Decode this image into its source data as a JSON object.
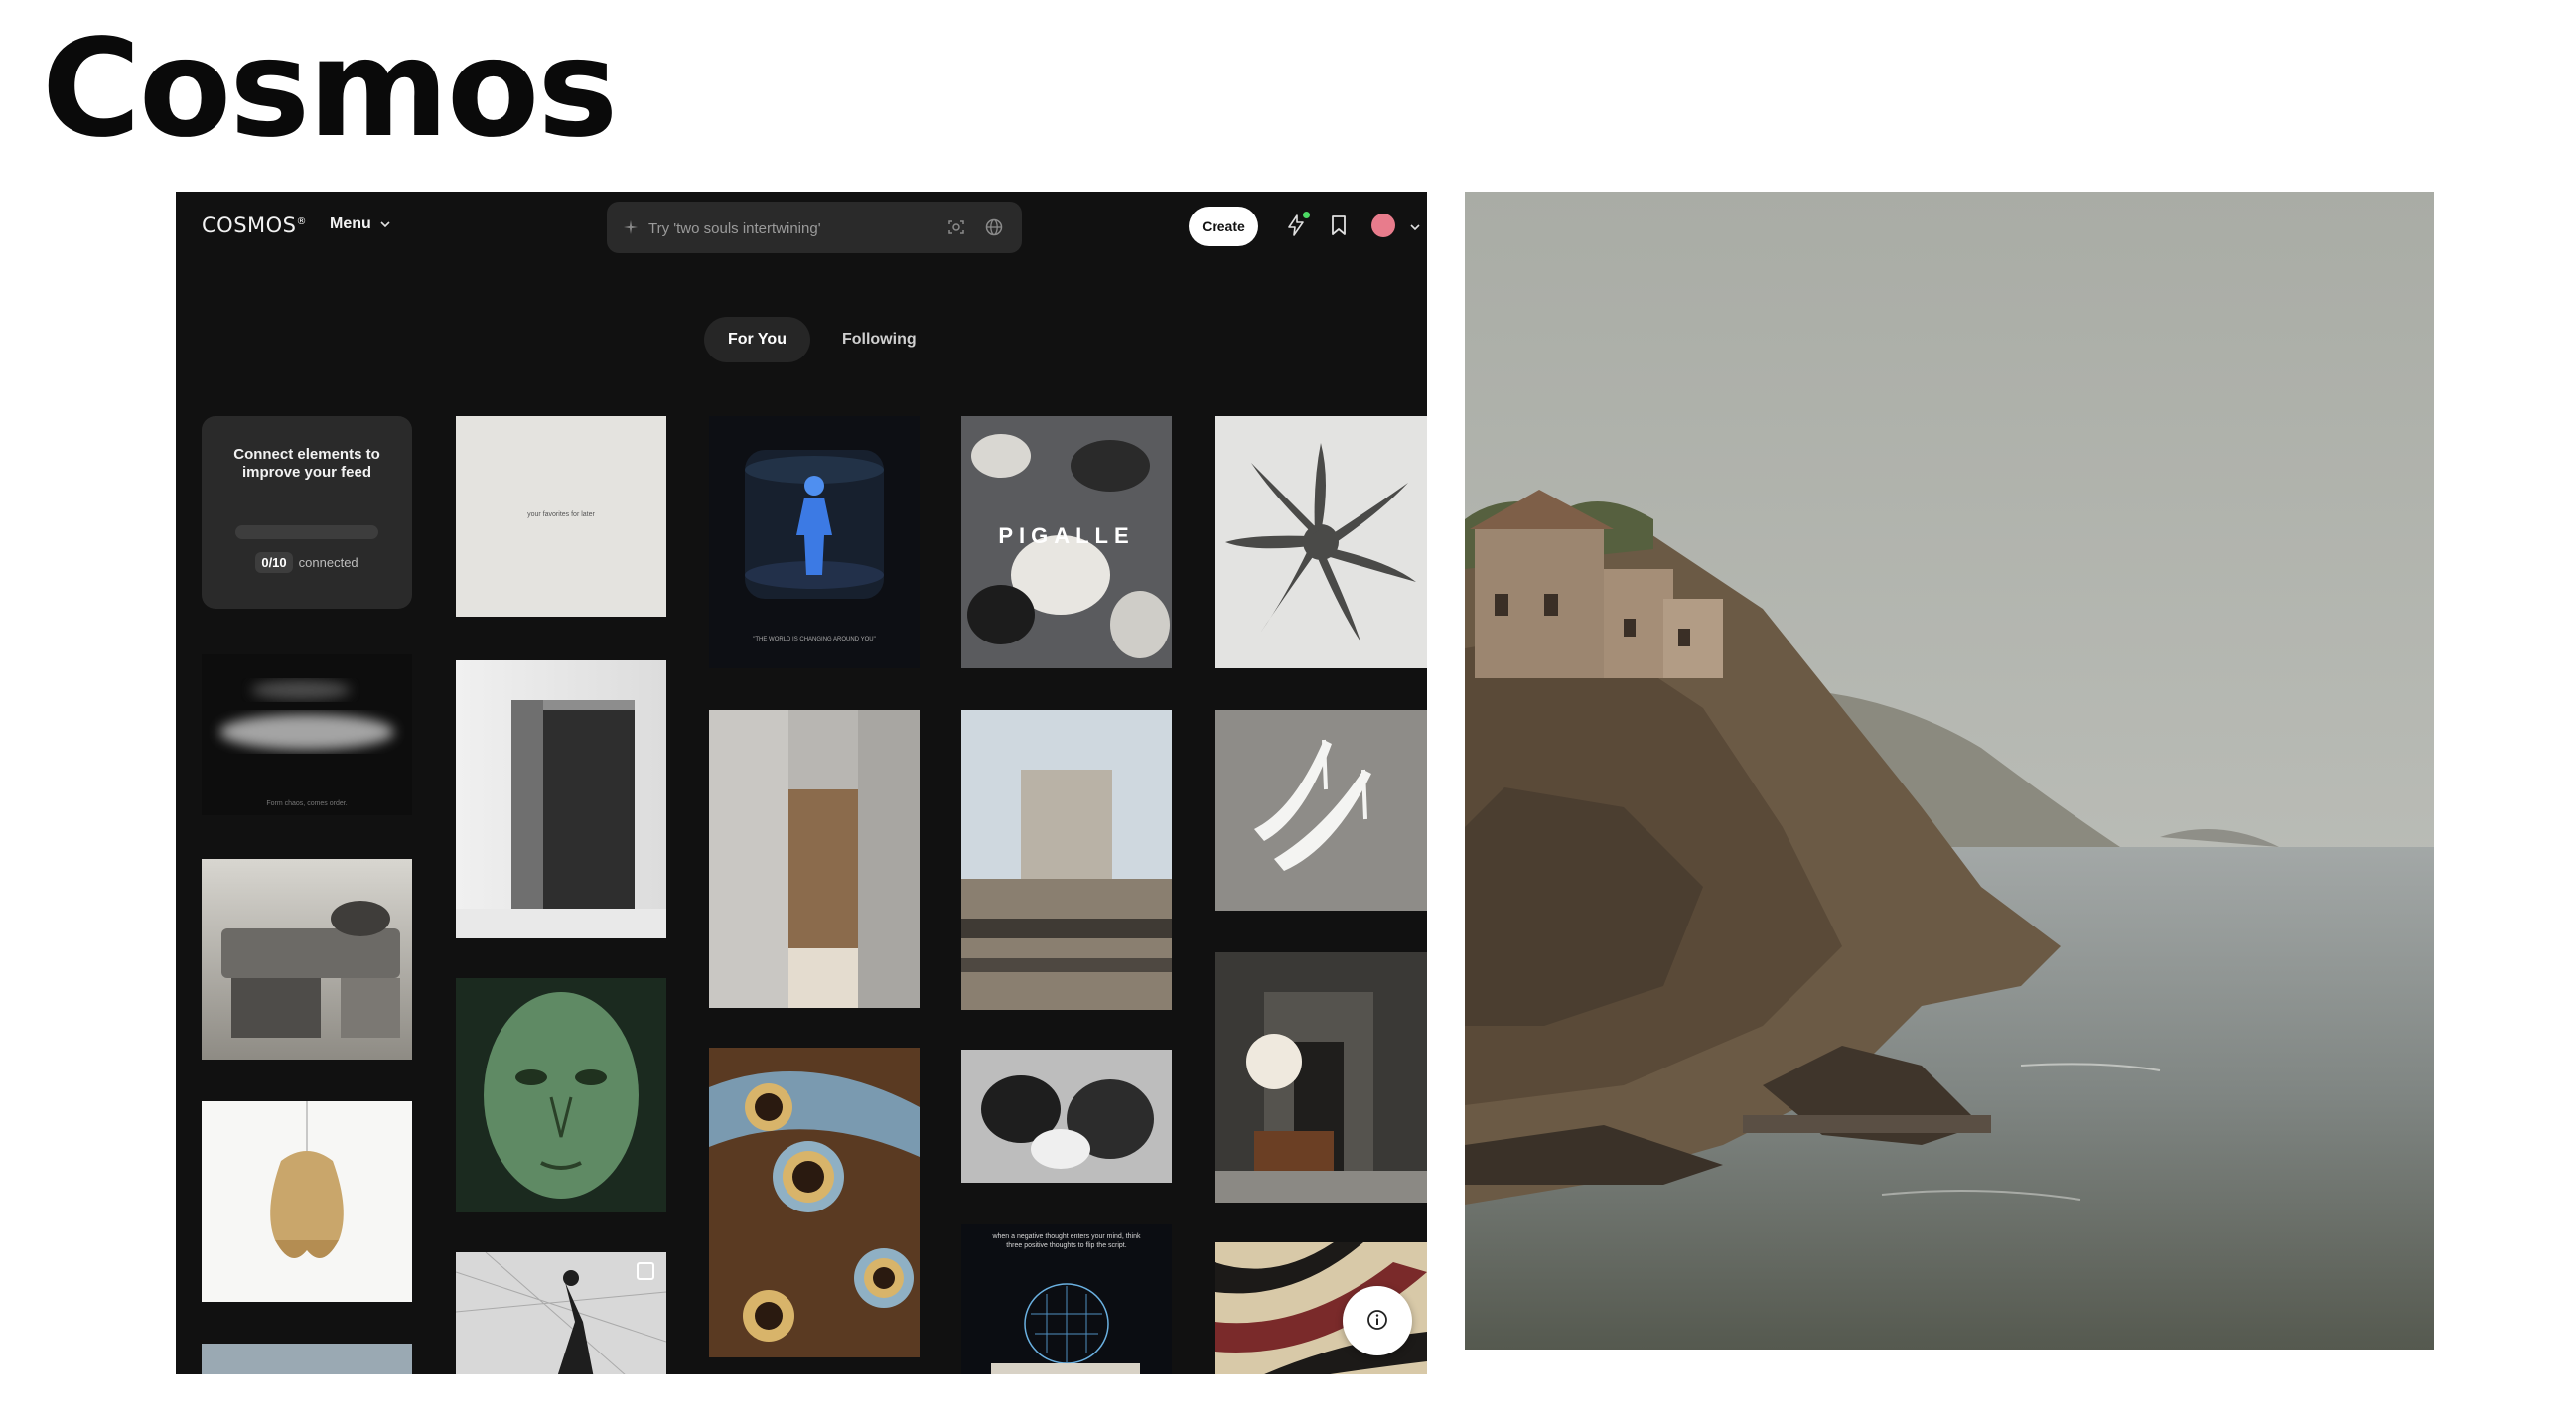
{
  "slide": {
    "title": "Cosmos"
  },
  "app": {
    "logo": "COSMOS",
    "logo_mark": "®",
    "menu_label": "Menu",
    "search": {
      "placeholder": "Try 'two souls intertwining'"
    },
    "create_label": "Create",
    "notification_color": "#4cd964",
    "avatar_color": "#e87c8c",
    "tabs": [
      {
        "label": "For You",
        "active": true
      },
      {
        "label": "Following",
        "active": false
      }
    ],
    "connect_card": {
      "title": "Connect elements to improve your feed",
      "count": "0/10",
      "count_label": "connected",
      "progress": 0.0
    },
    "feed_captions": {
      "paper_note": "your favorites for later",
      "dark_brush": "Form chaos, comes order.",
      "pigalle": "PIGALLE",
      "poster_footer": "\"THE WORLD IS CHANGING AROUND YOU\"",
      "quote": "when a negative thought enters your mind, think three positive thoughts to flip the script."
    }
  }
}
